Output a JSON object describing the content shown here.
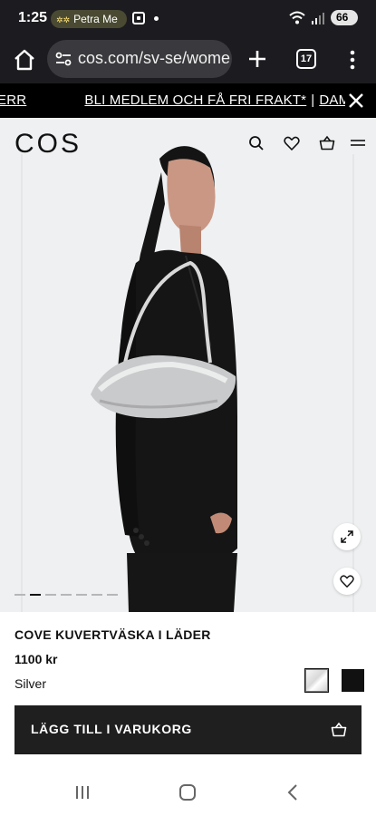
{
  "status_bar": {
    "time": "1:25",
    "notification_pill": "Petra Me",
    "battery": "66"
  },
  "browser": {
    "url": "cos.com/sv-se/wome",
    "tab_count": "17"
  },
  "promo_banner": {
    "items": [
      "HERR",
      "BLI MEDLEM OCH FÅ FRI FRAKT*",
      "DAM"
    ],
    "separator": "|"
  },
  "site": {
    "logo": "COS"
  },
  "gallery": {
    "image_count": 7,
    "active_index": 1
  },
  "product": {
    "name": "COVE KUVERTVÄSKA I LÄDER",
    "price": "1100 kr",
    "color": "Silver",
    "swatches": [
      {
        "name": "silver",
        "selected": true
      },
      {
        "name": "black",
        "selected": false
      }
    ],
    "add_to_cart_label": "LÄGG TILL I VARUKORG"
  },
  "colors": {
    "accent_dark": "#1f1f1f",
    "hero_background": "#eef0f1",
    "system_bar": "#1c1b1f"
  }
}
